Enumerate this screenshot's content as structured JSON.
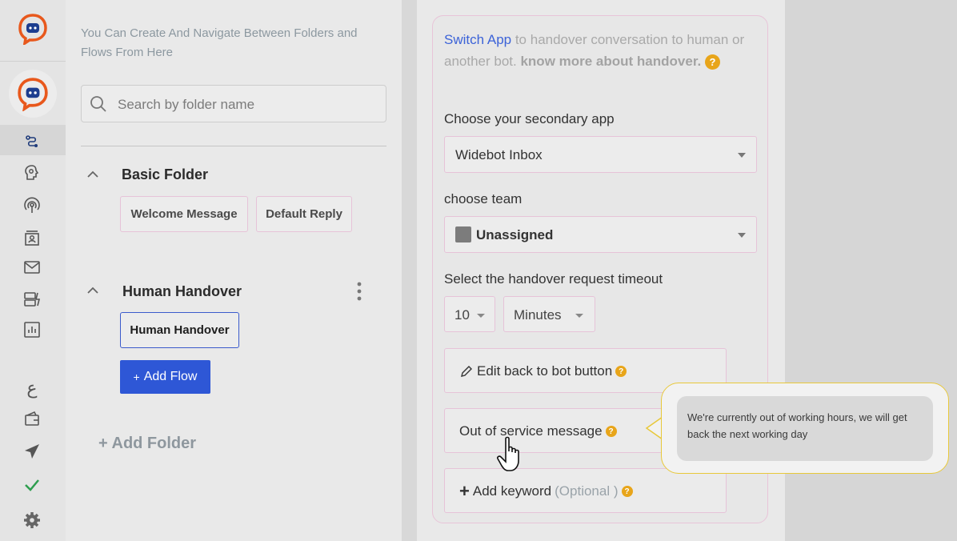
{
  "folders_panel": {
    "intro": "You Can Create And Navigate Between Folders and Flows From Here",
    "search_placeholder": "Search by folder name",
    "folders": [
      {
        "title": "Basic Folder",
        "flows": [
          "Welcome Message",
          "Default Reply"
        ]
      },
      {
        "title": "Human Handover",
        "flows": [
          "Human Handover"
        ]
      }
    ],
    "add_flow_label": "Add Flow",
    "add_folder_label": "+ Add Folder"
  },
  "rail": {
    "icons": [
      "widebot-logo",
      "bot-avatar",
      "flow-icon",
      "ai-brain-icon",
      "broadcast-icon",
      "contacts-icon",
      "mail-icon",
      "automation-icon",
      "analytics-icon",
      "language-icon",
      "wallet-icon",
      "send-icon",
      "check-icon",
      "settings-icon"
    ],
    "language_glyph": "ع"
  },
  "handover": {
    "switch_app": "Switch App",
    "desc_middle": " to handover conversation to human or another bot. ",
    "know_more": "know more about handover.",
    "secondary_label": "Choose your secondary app",
    "secondary_value": "Widebot Inbox",
    "team_label": "choose team",
    "team_value": "Unassigned",
    "timeout_label": "Select the handover request timeout",
    "timeout_value": "10",
    "timeout_unit": "Minutes",
    "edit_back_label": "Edit back to bot button",
    "out_of_service_label": "Out of service message",
    "add_keyword_label": "Add keyword",
    "optional_label": "(Optional )",
    "tooltip_text": "We're currently out of working hours, we will get back the next working day"
  },
  "colors": {
    "accent": "#2e57d6",
    "brand_orange": "#e8581c",
    "help": "#e8a51a",
    "link": "#3c63d8",
    "check": "#2e9e4f"
  }
}
